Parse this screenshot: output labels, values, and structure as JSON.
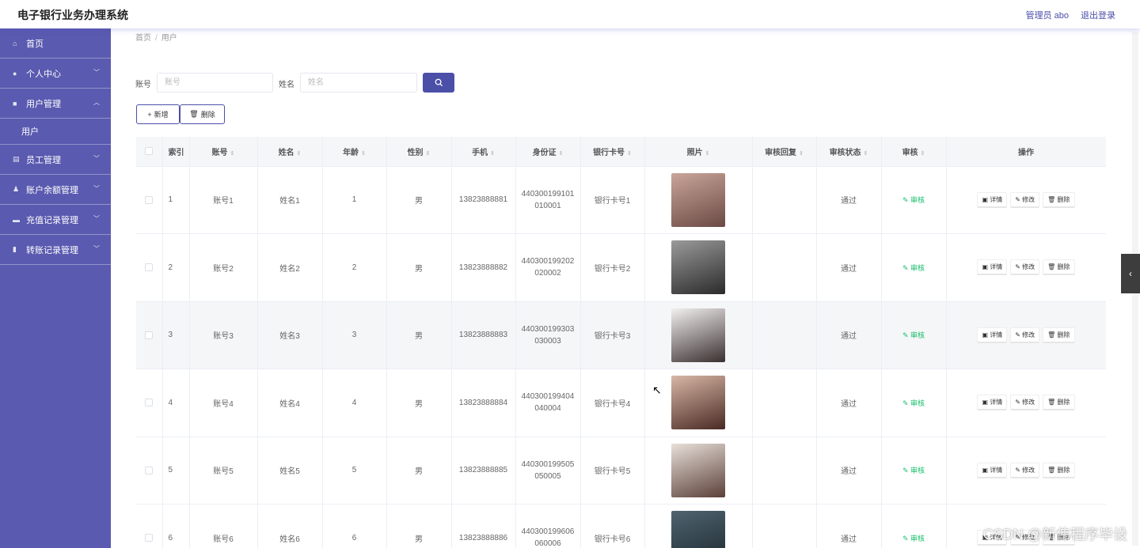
{
  "app": {
    "title": "电子银行业务办理系统",
    "admin": "管理员 abo",
    "logout": "退出登录"
  },
  "sidebar": {
    "items": [
      {
        "icon": "home-icon",
        "glyph": "⌂",
        "label": "首页",
        "chevron": false
      },
      {
        "icon": "user-icon",
        "glyph": "●",
        "label": "个人中心",
        "chevron": true,
        "open": false
      },
      {
        "icon": "folder-icon",
        "glyph": "■",
        "label": "用户管理",
        "chevron": true,
        "open": true
      },
      {
        "icon": "doc-icon",
        "glyph": "▤",
        "label": "员工管理",
        "chevron": true,
        "open": false
      },
      {
        "icon": "person-icon",
        "glyph": "♟",
        "label": "账户余额管理",
        "chevron": true,
        "open": false
      },
      {
        "icon": "card-icon",
        "glyph": "▬",
        "label": "充值记录管理",
        "chevron": true,
        "open": false
      },
      {
        "icon": "chart-icon",
        "glyph": "▮",
        "label": "转账记录管理",
        "chevron": true,
        "open": false
      }
    ],
    "sub_user": "用户"
  },
  "breadcrumb": {
    "home": "首页",
    "sep": "/",
    "current": "用户"
  },
  "search": {
    "account_label": "账号",
    "account_placeholder": "账号",
    "name_label": "姓名",
    "name_placeholder": "姓名"
  },
  "actions": {
    "add": "新增",
    "delete": "删除"
  },
  "table": {
    "columns": [
      "索引",
      "账号",
      "姓名",
      "年龄",
      "性别",
      "手机",
      "身份证",
      "银行卡号",
      "照片",
      "审核回复",
      "审核状态",
      "审核",
      "操作"
    ],
    "rows": [
      {
        "index": "1",
        "account": "账号1",
        "name": "姓名1",
        "age": "1",
        "gender": "男",
        "phone": "13823888881",
        "idcard": "440300199101010001",
        "bankcard": "银行卡号1",
        "reply": "",
        "status": "通过",
        "audit": "审核",
        "photo_colors": [
          "#c9a59a",
          "#6b4a44"
        ]
      },
      {
        "index": "2",
        "account": "账号2",
        "name": "姓名2",
        "age": "2",
        "gender": "男",
        "phone": "13823888882",
        "idcard": "440300199202020002",
        "bankcard": "银行卡号2",
        "reply": "",
        "status": "通过",
        "audit": "审核",
        "photo_colors": [
          "#9a9a9a",
          "#2b2b2b"
        ]
      },
      {
        "index": "3",
        "account": "账号3",
        "name": "姓名3",
        "age": "3",
        "gender": "男",
        "phone": "13823888883",
        "idcard": "440300199303030003",
        "bankcard": "银行卡号3",
        "reply": "",
        "status": "通过",
        "audit": "审核",
        "photo_colors": [
          "#f2f0ee",
          "#3a3030"
        ]
      },
      {
        "index": "4",
        "account": "账号4",
        "name": "姓名4",
        "age": "4",
        "gender": "男",
        "phone": "13823888884",
        "idcard": "440300199404040004",
        "bankcard": "银行卡号4",
        "reply": "",
        "status": "通过",
        "audit": "审核",
        "photo_colors": [
          "#d8b6a6",
          "#4a2a24"
        ]
      },
      {
        "index": "5",
        "account": "账号5",
        "name": "姓名5",
        "age": "5",
        "gender": "男",
        "phone": "13823888885",
        "idcard": "440300199505050005",
        "bankcard": "银行卡号5",
        "reply": "",
        "status": "通过",
        "audit": "审核",
        "photo_colors": [
          "#e8e0da",
          "#5b4038"
        ]
      },
      {
        "index": "6",
        "account": "账号6",
        "name": "姓名6",
        "age": "6",
        "gender": "男",
        "phone": "13823888886",
        "idcard": "440300199606060006",
        "bankcard": "银行卡号6",
        "reply": "",
        "status": "通过",
        "audit": "审核",
        "photo_colors": [
          "#4f6370",
          "#1e2a30"
        ]
      }
    ],
    "ops": {
      "detail": "详情",
      "edit": "修改",
      "delete": "删除"
    }
  },
  "watermark": "CSDN @新伟程序毕设",
  "colors": {
    "sidebar": "#5a5ab0",
    "primary": "#4b4fa8",
    "audit": "#19be6b"
  }
}
